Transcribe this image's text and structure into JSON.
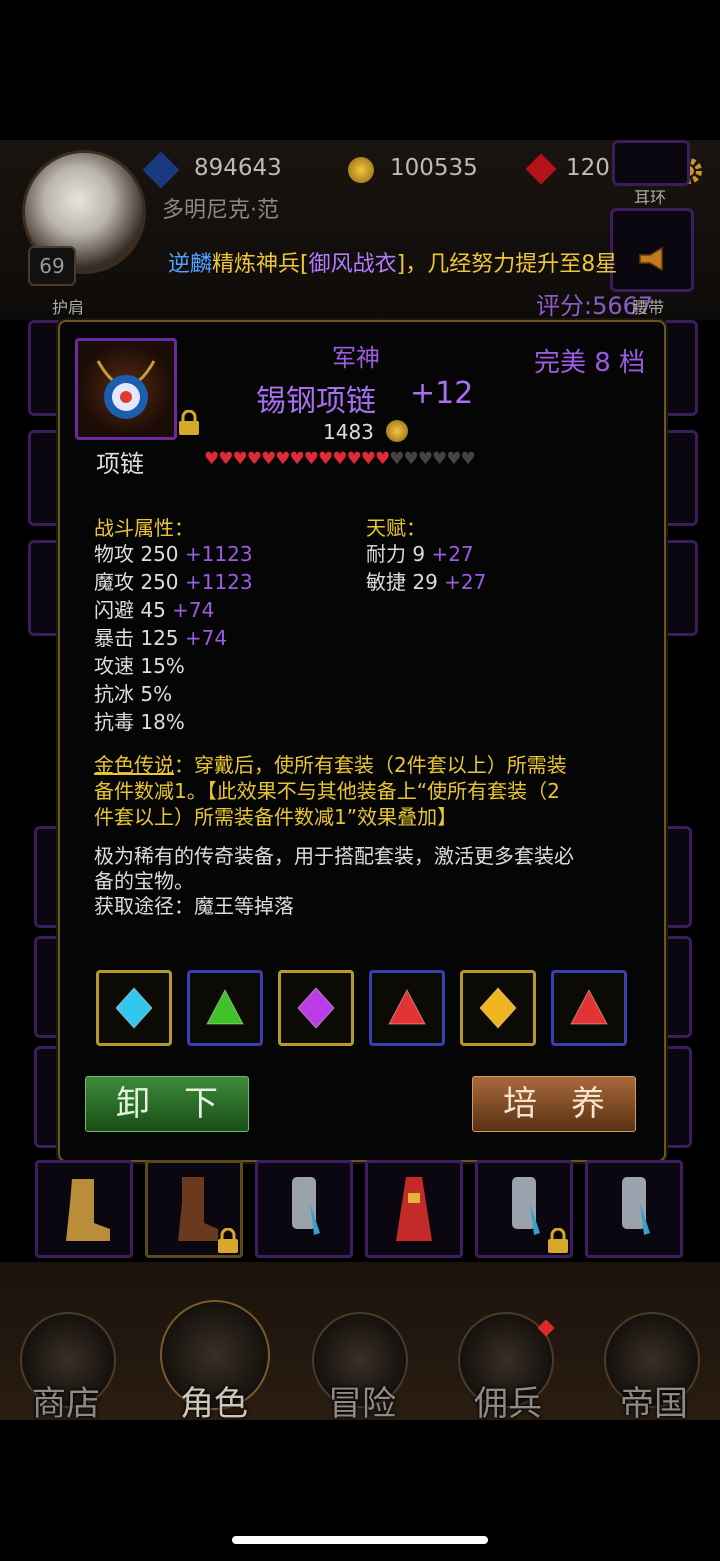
{
  "header": {
    "power": "894643",
    "gold": "100535",
    "gems": "120",
    "player_name": "多明尼克·范",
    "level": "69",
    "announcement": {
      "prefix": "逆麟",
      "middle1": "精炼神兵[",
      "item": "御风战衣",
      "middle2": "]，几经努力提升至8星"
    },
    "score": "评分:5667",
    "slot_labels": {
      "shoulder": "护肩",
      "earring": "耳环",
      "belt": "腰带"
    }
  },
  "item_detail": {
    "series": "军神",
    "quality": "完美 8 档",
    "name": "锡钢项链",
    "enhance": "+12",
    "price": "1483",
    "type": "项链",
    "stars_filled": 13,
    "stars_total": 19,
    "combat_title": "战斗属性：",
    "combat_stats": [
      {
        "label": "物攻 250",
        "bonus": "+1123"
      },
      {
        "label": "魔攻 250",
        "bonus": "+1123"
      },
      {
        "label": "闪避 45",
        "bonus": "+74"
      },
      {
        "label": "暴击 125",
        "bonus": "+74"
      },
      {
        "label": "攻速 15%",
        "bonus": ""
      },
      {
        "label": "抗冰 5%",
        "bonus": ""
      },
      {
        "label": "抗毒 18%",
        "bonus": ""
      }
    ],
    "talent_title": "天赋：",
    "talent_stats": [
      {
        "label": "耐力 9",
        "bonus": "+27"
      },
      {
        "label": "敏捷 29",
        "bonus": "+27"
      }
    ],
    "legend_name": "金色传说",
    "legend_text_1": "：穿戴后，使所有套装（2件套以上）所需装",
    "legend_text_2": "备件数减1。【此效果不与其他装备上“使所有套装（2",
    "legend_text_3": "件套以上）所需装备件数减1”效果叠加】",
    "desc_1": "极为稀有的传奇装备，用于搭配套装，激活更多套装必",
    "desc_2": "备的宝物。",
    "source": "获取途径：魔王等掉落",
    "gems": [
      {
        "name": "blue-diamond-gem",
        "color": "#35c6f0",
        "frame": "#b59a2a"
      },
      {
        "name": "green-triangle-gem",
        "color": "#3fc22a",
        "frame": "#3b3fb0"
      },
      {
        "name": "purple-diamond-gem",
        "color": "#b93ce8",
        "frame": "#b59a2a"
      },
      {
        "name": "red-triangle-gem",
        "color": "#e23434",
        "frame": "#3b3fb0"
      },
      {
        "name": "yellow-diamond-gem",
        "color": "#f0b51e",
        "frame": "#b59a2a"
      },
      {
        "name": "red-triangle-gem",
        "color": "#e23434",
        "frame": "#3b3fb0"
      }
    ],
    "unequip_label": "卸　下",
    "train_label": "培　养"
  },
  "nav": {
    "shop": "商店",
    "character": "角色",
    "adventure": "冒险",
    "mercenary": "佣兵",
    "empire": "帝国"
  }
}
